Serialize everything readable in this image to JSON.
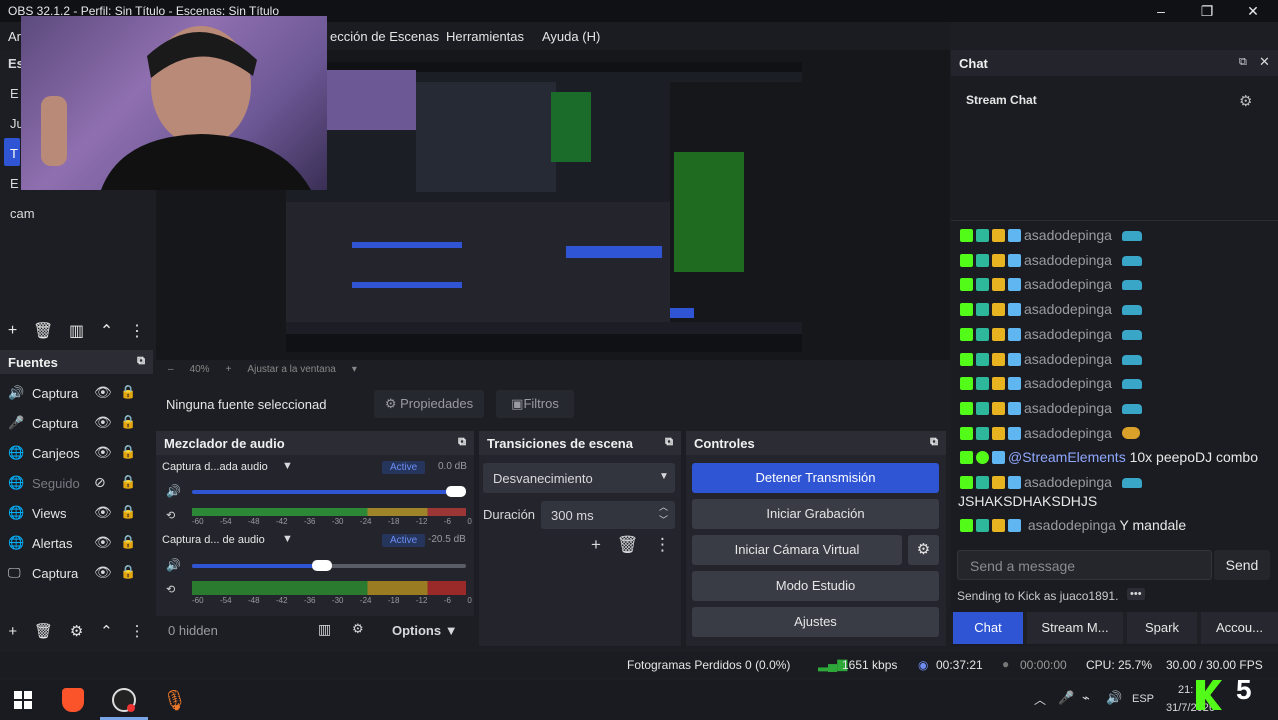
{
  "window": {
    "title": "OBS 32.1.2 - Perfil: Sin Título - Escenas: Sin Título",
    "controls": [
      "–",
      "❐",
      "✕"
    ]
  },
  "menu": {
    "items": [
      "Ar",
      "ección de Escenas",
      "Herramientas",
      "Ayuda (H)"
    ]
  },
  "scenes": {
    "header": "Es",
    "items": [
      "E",
      "Ju",
      "T",
      "E",
      "cam"
    ]
  },
  "preview_bar": {
    "minus": "–",
    "zoom": "40%",
    "plus": "+",
    "fit": "Ajustar a la ventana"
  },
  "source_toolbar": {
    "status": "Ninguna fuente seleccionad",
    "properties": "Propiedades",
    "filters": "Filtros"
  },
  "sources": {
    "header": "Fuentes",
    "items": [
      {
        "label": "Captura",
        "icon": "speaker-icon",
        "dim": false
      },
      {
        "label": "Captura",
        "icon": "microphone-icon",
        "dim": false
      },
      {
        "label": "Canjeos",
        "icon": "globe-icon",
        "dim": false
      },
      {
        "label": "Seguido",
        "icon": "globe-icon",
        "dim": true
      },
      {
        "label": "Views",
        "icon": "globe-icon",
        "dim": false
      },
      {
        "label": "Alertas",
        "icon": "globe-icon",
        "dim": false
      },
      {
        "label": "Captura",
        "icon": "monitor-icon",
        "dim": false
      }
    ]
  },
  "mixer": {
    "header": "Mezclador de audio",
    "channels": [
      {
        "name": "Captura d...ada audio",
        "badge": "Active",
        "db": "0.0 dB",
        "volume": 1.0
      },
      {
        "name": "Captura d... de audio",
        "badge": "Active",
        "db": "-20.5 dB",
        "volume": 0.47
      }
    ],
    "ticks": [
      "-60",
      "-54",
      "-48",
      "-42",
      "-36",
      "-30",
      "-24",
      "-18",
      "-12",
      "-6",
      "0"
    ],
    "footer_hidden": "0 hidden",
    "footer_options": "Options"
  },
  "transitions": {
    "header": "Transiciones de escena",
    "selected": "Desvanecimiento",
    "duration_label": "Duración",
    "duration_value": "300 ms"
  },
  "controls": {
    "header": "Controles",
    "buttons": [
      "Detener Transmisión",
      "Iniciar Grabación",
      "Iniciar Cámara Virtual",
      "Modo Estudio",
      "Ajustes"
    ]
  },
  "chat": {
    "dock_title": "Chat",
    "stream_chat_title": "Stream Chat",
    "messages": [
      {
        "user": "asadodepinga",
        "text": "",
        "color": "#9a9aa0"
      },
      {
        "user": "asadodepinga",
        "text": "",
        "color": "#9a9aa0"
      },
      {
        "user": "asadodepinga",
        "text": "",
        "color": "#9a9aa0"
      },
      {
        "user": "asadodepinga",
        "text": "",
        "color": "#9a9aa0"
      },
      {
        "user": "asadodepinga",
        "text": "",
        "color": "#9a9aa0"
      },
      {
        "user": "asadodepinga",
        "text": "",
        "color": "#9a9aa0"
      },
      {
        "user": "asadodepinga",
        "text": "",
        "color": "#9a9aa0"
      },
      {
        "user": "asadodepinga",
        "text": "",
        "color": "#9a9aa0"
      },
      {
        "user": "asadodepinga",
        "text": "",
        "color": "#9a9aa0"
      },
      {
        "user": "@StreamElements",
        "text": "10x peepoDJ combo",
        "color": "#8fa8ff"
      },
      {
        "user": "asadodepinga",
        "text": "",
        "color": "#9a9aa0"
      }
    ],
    "wrapped_line": "JSHAKSDHAKSDHJS",
    "last_message": {
      "user": "asadodepinga",
      "text": "Y mandale"
    },
    "input_placeholder": "Send a message",
    "send_label": "Send",
    "sending_as": "Sending to Kick as juaco1891.",
    "tabs": [
      "Chat",
      "Stream M...",
      "Spark",
      "Accou..."
    ]
  },
  "status": {
    "dropped": "Fotogramas Perdidos 0 (0.0%)",
    "bitrate": "1651 kbps",
    "live_time": "00:37:21",
    "rec_time": "00:00:00",
    "cpu": "CPU: 25.7%",
    "fps": "30.00 / 30.00 FPS"
  },
  "taskbar": {
    "lang": "ESP",
    "time": "21:",
    "date": "31/7/2026"
  },
  "colors": {
    "accent": "#2f55d4",
    "kick_green": "#53fc18",
    "meter_green": "#2fa83a",
    "meter_yellow": "#c8a42a",
    "meter_red": "#c33a3a"
  }
}
